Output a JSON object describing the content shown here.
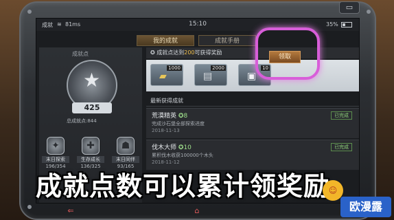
{
  "status_bar": {
    "carrier": "成就",
    "speed": "81ms",
    "time": "15:10",
    "battery": "35%",
    "battery_level": 0.35
  },
  "tabs": [
    {
      "label": "我的成就",
      "active": true
    },
    {
      "label": "成就手册",
      "active": false
    }
  ],
  "points_panel": {
    "title": "成就点",
    "score": "425",
    "total": "总成就点:844"
  },
  "badges": [
    {
      "name": "末日探索",
      "count": "196/354"
    },
    {
      "name": "生存成长",
      "count": "136/325"
    },
    {
      "name": "末日同伴",
      "count": "93/165"
    }
  ],
  "reward": {
    "header_prefix": "成就点达到",
    "header_value": "200",
    "header_suffix": "可获得奖励",
    "items": [
      {
        "qty": "1000",
        "icon": "gold-bars-icon"
      },
      {
        "qty": "2000",
        "icon": "cash-stack-icon"
      },
      {
        "qty": "10",
        "icon": "ticket-icon"
      }
    ],
    "claim_label": "领取"
  },
  "recent": {
    "title": "最新获得成就",
    "items": [
      {
        "name": "荒漠精英",
        "points": "8",
        "desc": "完成沙石堡全部探索进度",
        "date": "2018-11-13",
        "status": "已完成"
      },
      {
        "name": "伐木大师",
        "points": "10",
        "desc": "累积伐木收获100000个木头",
        "date": "2018-11-12",
        "status": "已完成"
      }
    ]
  },
  "caption": "成就点数可以累计领奖励",
  "watermark": "欧漫露",
  "colors": {
    "accent": "#d85ed9",
    "claim": "#b47a3e",
    "highlight_text": "#f2c14e"
  }
}
